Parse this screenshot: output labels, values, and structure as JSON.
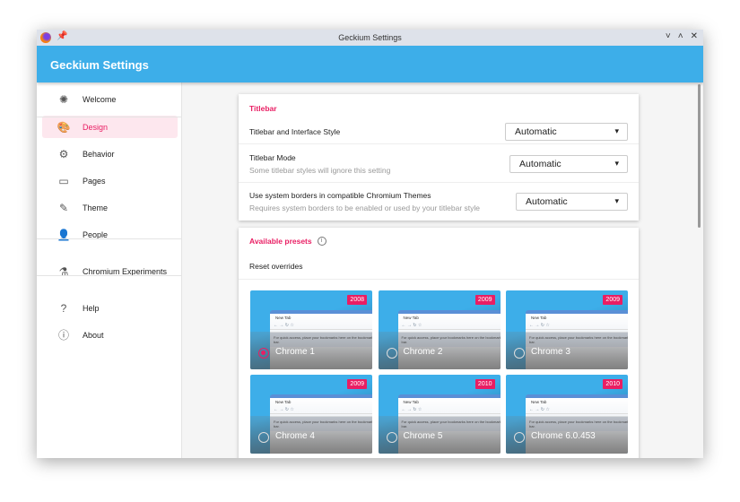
{
  "window": {
    "title": "Geckium Settings",
    "icons": [
      "firefox-icon",
      "pin-icon"
    ],
    "controls": [
      "˅",
      "˄",
      "✕"
    ]
  },
  "header": {
    "title": "Geckium Settings"
  },
  "colors": {
    "accent": "#e91e63",
    "header": "#3daee9"
  },
  "sidebar": {
    "items": [
      {
        "label": "Welcome",
        "icon": "✺"
      },
      {
        "label": "Design",
        "icon": "🎨",
        "active": true
      },
      {
        "label": "Behavior",
        "icon": "⚙"
      },
      {
        "label": "Pages",
        "icon": "▭"
      },
      {
        "label": "Theme",
        "icon": "✎"
      },
      {
        "label": "People",
        "icon": "👤"
      },
      {
        "label": "Chromium Experiments",
        "icon": "⚗"
      },
      {
        "label": "Help",
        "icon": "?"
      },
      {
        "label": "About",
        "icon": "ⓘ"
      }
    ]
  },
  "titlebar": {
    "heading": "Titlebar",
    "settings": [
      {
        "label": "Titlebar and Interface Style",
        "sub": "",
        "value": "Automatic"
      },
      {
        "label": "Titlebar Mode",
        "sub": "Some titlebar styles will ignore this setting",
        "value": "Automatic"
      },
      {
        "label": "Use system borders in compatible Chromium Themes",
        "sub": "Requires system borders to be enabled or used by your titlebar style",
        "value": "Automatic"
      }
    ]
  },
  "presets": {
    "heading": "Available presets",
    "reset": "Reset overrides",
    "tab_label": "New Tab",
    "bookmarks_text": "For quick access, place your bookmarks here on the bookmarks bar.",
    "items": [
      {
        "name": "Chrome 1",
        "year": "2008",
        "selected": true
      },
      {
        "name": "Chrome 2",
        "year": "2009"
      },
      {
        "name": "Chrome 3",
        "year": "2009"
      },
      {
        "name": "Chrome 4",
        "year": "2009"
      },
      {
        "name": "Chrome 5",
        "year": "2010"
      },
      {
        "name": "Chrome 6.0.453",
        "year": "2010"
      }
    ]
  }
}
